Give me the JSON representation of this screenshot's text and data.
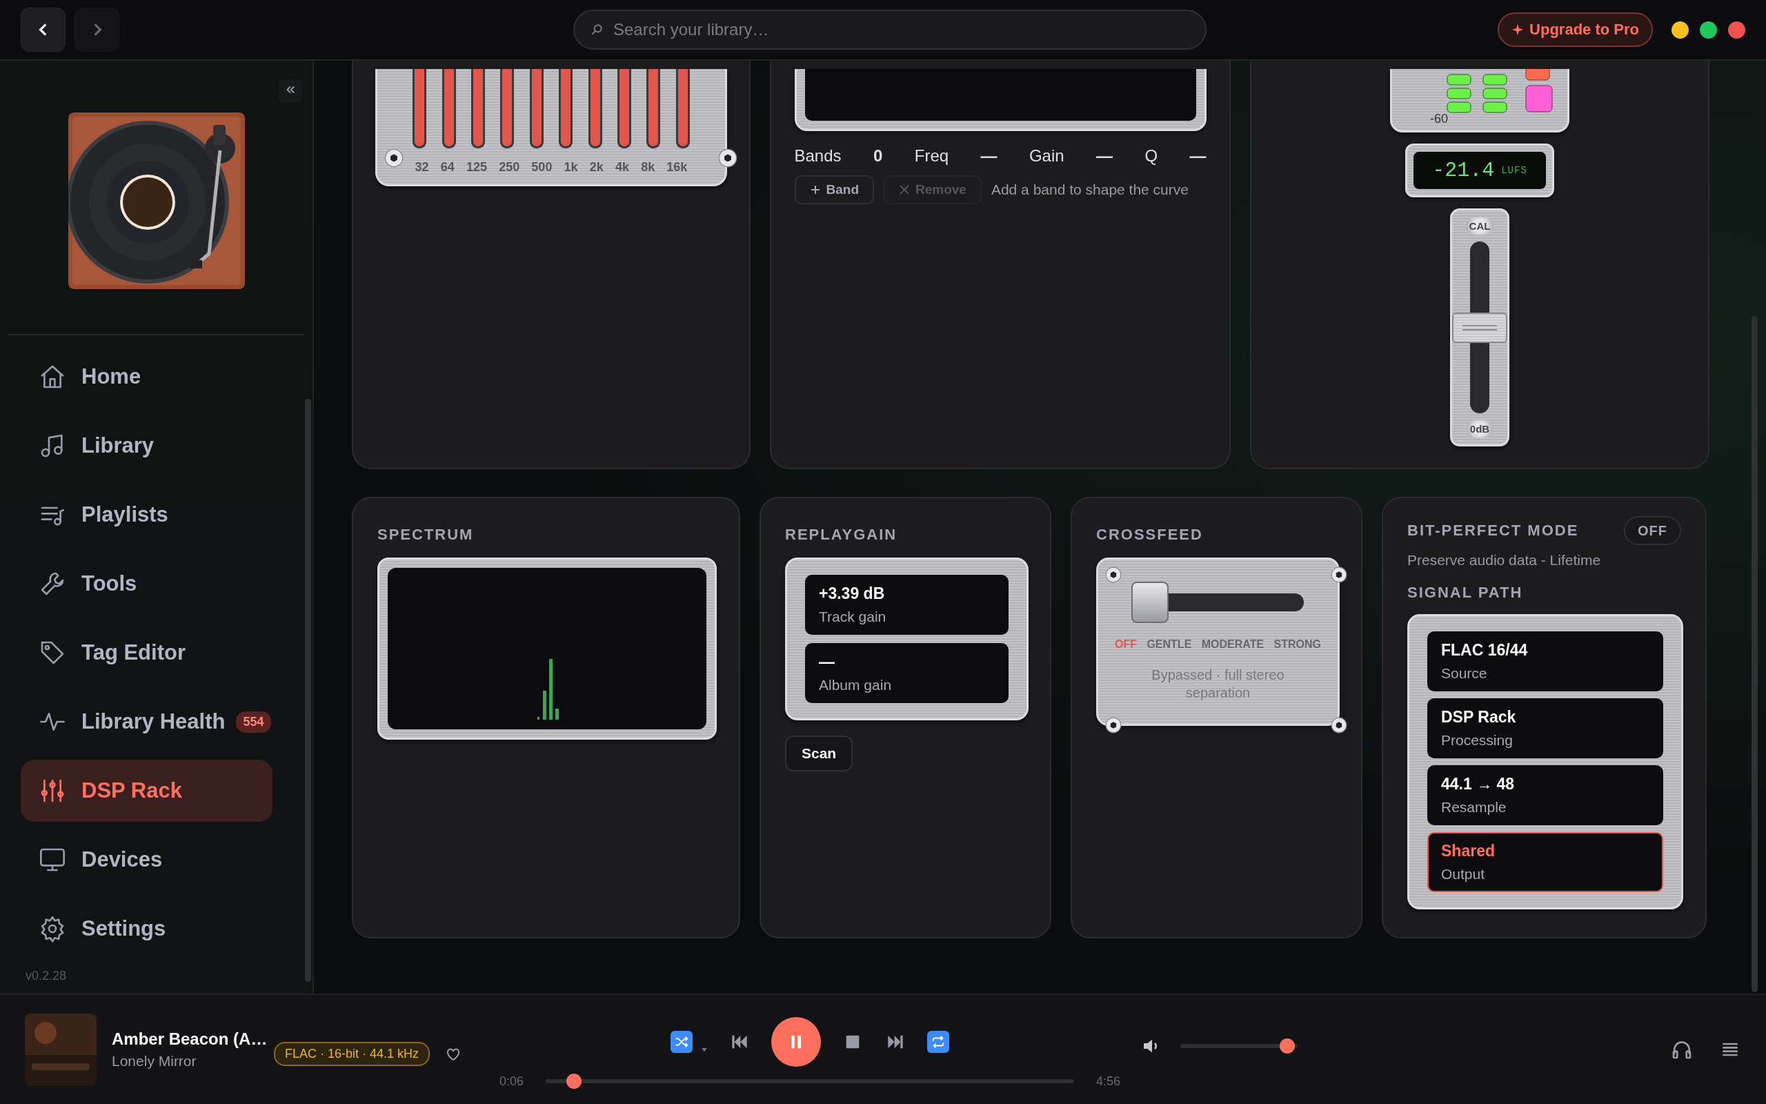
{
  "search": {
    "placeholder": "Search your library…"
  },
  "upgrade_button": {
    "label": "Upgrade to Pro"
  },
  "sidebar": {
    "version": "v0.2.28",
    "items": [
      {
        "label": "Home",
        "kind": "home",
        "selected": false
      },
      {
        "label": "Library",
        "kind": "music",
        "selected": false
      },
      {
        "label": "Playlists",
        "kind": "playlist",
        "selected": false
      },
      {
        "label": "Tools",
        "kind": "wrench",
        "selected": false
      },
      {
        "label": "Tag Editor",
        "kind": "tag",
        "selected": false
      },
      {
        "label": "Library Health",
        "kind": "pulse",
        "selected": false,
        "badge": "554"
      },
      {
        "label": "DSP Rack",
        "kind": "sliders",
        "selected": true
      },
      {
        "label": "Devices",
        "kind": "monitor",
        "selected": false
      },
      {
        "label": "Settings",
        "kind": "gear",
        "selected": false
      }
    ]
  },
  "equalizer": {
    "bands": [
      {
        "label": "32",
        "level": 1
      },
      {
        "label": "64",
        "level": 1
      },
      {
        "label": "125",
        "level": 1
      },
      {
        "label": "250",
        "level": 1
      },
      {
        "label": "500",
        "level": 1
      },
      {
        "label": "1k",
        "level": 1
      },
      {
        "label": "2k",
        "level": 1
      },
      {
        "label": "4k",
        "level": 1
      },
      {
        "label": "8k",
        "level": 1
      },
      {
        "label": "16k",
        "level": 1
      }
    ]
  },
  "parametric_eq": {
    "stats": [
      {
        "label": "Bands",
        "value": "0"
      },
      {
        "label": "Freq",
        "value": "—"
      },
      {
        "label": "Gain",
        "value": "—"
      },
      {
        "label": "Q",
        "value": "—"
      }
    ],
    "add_button": {
      "label": "Band"
    },
    "remove_button": {
      "label": "Remove",
      "disabled": true
    },
    "hint": "Add a band to shape the curve"
  },
  "meter": {
    "scale_label": "-60",
    "reading": "-21.4",
    "unit": "LUFS",
    "fader": {
      "top_label": "CAL",
      "bottom_label": "0dB",
      "level": 0.5
    }
  },
  "spectrum": {
    "title": "SPECTRUM"
  },
  "replaygain": {
    "title": "REPLAYGAIN",
    "readouts": [
      {
        "value": "+3.39 dB",
        "label": "Track gain"
      },
      {
        "value": "—",
        "label": "Album gain"
      }
    ],
    "scan_button": "Scan"
  },
  "crossfeed": {
    "title": "CROSSFEED",
    "level": 0,
    "options": [
      {
        "label": "OFF",
        "selected": true
      },
      {
        "label": "GENTLE",
        "selected": false
      },
      {
        "label": "MODERATE",
        "selected": false
      },
      {
        "label": "STRONG",
        "selected": false
      }
    ],
    "status": "Bypassed · full stereo separation"
  },
  "bit_perfect": {
    "title": "BIT-PERFECT MODE",
    "toggle": {
      "label": "OFF",
      "on": false
    },
    "subtitle": "Preserve audio data - Lifetime",
    "signal_path_title": "SIGNAL PATH",
    "stages": [
      {
        "value": "FLAC 16/44",
        "label": "Source",
        "warning": false
      },
      {
        "value": "DSP Rack",
        "label": "Processing",
        "warning": false
      },
      {
        "value": "44.1 → 48",
        "label": "Resample",
        "warning": false
      },
      {
        "value": "Shared",
        "label": "Output",
        "warning": true
      }
    ]
  },
  "player": {
    "title": "Amber Beacon (A…",
    "artist": "Lonely Mirror",
    "format": "FLAC · 16-bit · 44.1 kHz",
    "liked": false,
    "shuffle": true,
    "repeat": true,
    "playing": true,
    "elapsed": "0:06",
    "duration": "4:56",
    "progress": {
      "level": 0.04
    },
    "volume": {
      "level": 0.97
    }
  }
}
